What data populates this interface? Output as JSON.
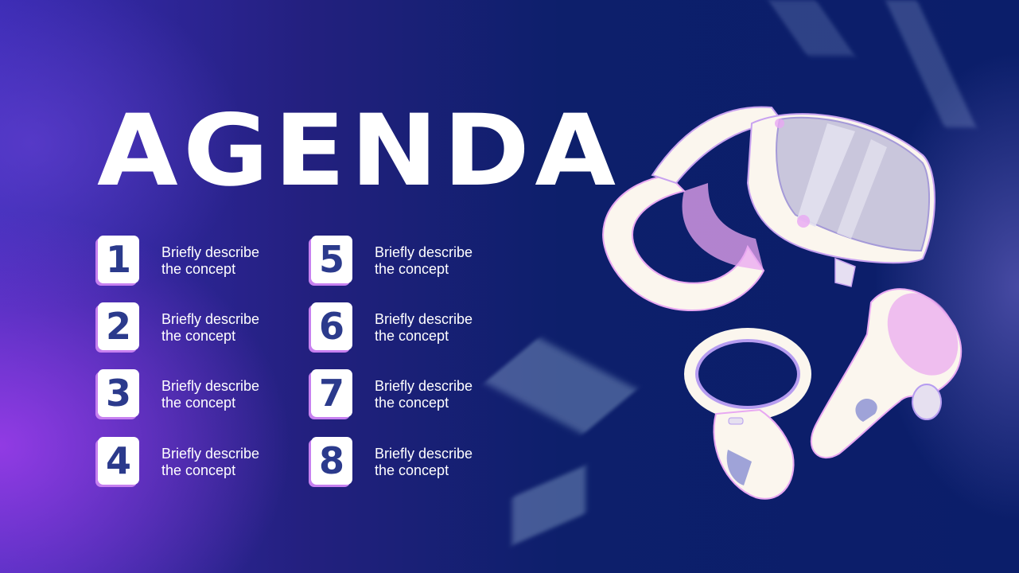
{
  "slide": {
    "title": "AGENDA",
    "items": [
      {
        "number": "1",
        "line1": "Briefly describe",
        "line2": "the concept"
      },
      {
        "number": "2",
        "line1": "Briefly describe",
        "line2": "the concept"
      },
      {
        "number": "3",
        "line1": "Briefly describe",
        "line2": "the concept"
      },
      {
        "number": "4",
        "line1": "Briefly describe",
        "line2": "the concept"
      },
      {
        "number": "5",
        "line1": "Briefly describe",
        "line2": "the concept"
      },
      {
        "number": "6",
        "line1": "Briefly describe",
        "line2": "the concept"
      },
      {
        "number": "7",
        "line1": "Briefly describe",
        "line2": "the concept"
      },
      {
        "number": "8",
        "line1": "Briefly describe",
        "line2": "the concept"
      }
    ]
  },
  "colors": {
    "background": "#0d1f6b",
    "accent_purple": "#9b3ce6",
    "number_text": "#2b3a8c",
    "number_shadow": "#c780f0",
    "headset_body": "#fbf6ee",
    "headset_accent": "#e8a8f2"
  },
  "illustration": {
    "icon": "vr-headset-with-controllers-icon"
  }
}
